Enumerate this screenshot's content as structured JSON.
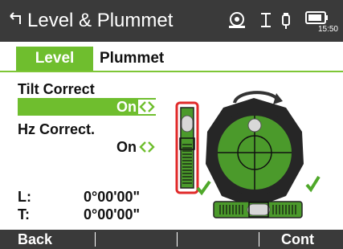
{
  "header": {
    "title": "Level & Plummet",
    "time": "15:50",
    "icons": [
      "back-arrow-icon",
      "target-icon",
      "instrument-icon",
      "battery-icon"
    ]
  },
  "tabs": [
    {
      "label": "Level",
      "selected": true
    },
    {
      "label": "Plummet",
      "selected": false
    }
  ],
  "fields": {
    "tilt": {
      "label": "Tilt Correct",
      "value": "On"
    },
    "hz": {
      "label": "Hz Correct.",
      "value": "On"
    }
  },
  "readouts": {
    "L": {
      "label": "L:",
      "value": "0°00'00\""
    },
    "T": {
      "label": "T:",
      "value": "0°00'00\""
    }
  },
  "softkeys": [
    "Back",
    "",
    "",
    "Cont"
  ],
  "colors": {
    "header_bg": "#3a3a3a",
    "accent_green": "#6fbe2e",
    "vial_green": "#4b9a2b",
    "alert_red": "#e02a2a",
    "check_green": "#4fa82a"
  }
}
